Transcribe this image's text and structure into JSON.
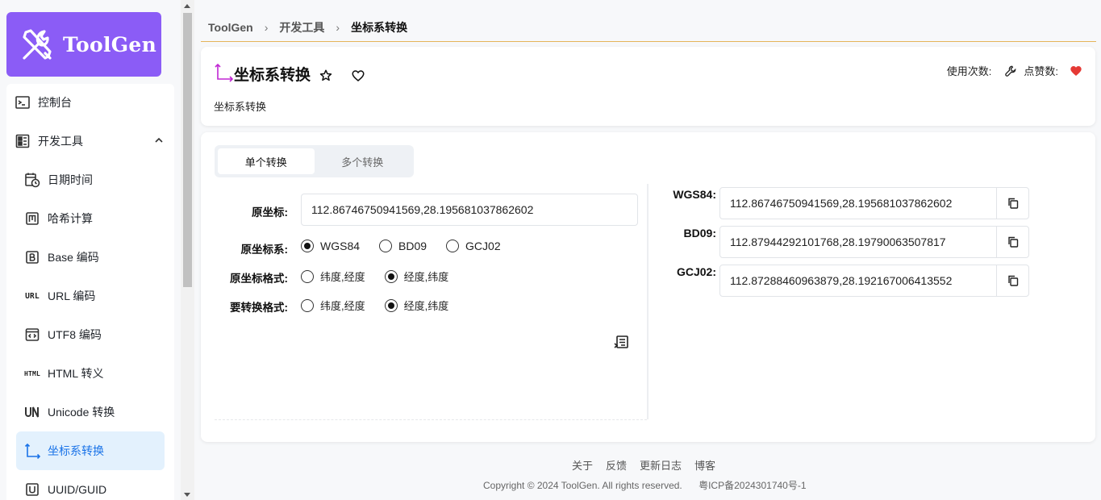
{
  "app": {
    "name": "ToolGen"
  },
  "breadcrumb": [
    "ToolGen",
    "开发工具",
    "坐标系转换"
  ],
  "sidebar": {
    "items": [
      {
        "label": "控制台",
        "icon": "terminal-icon"
      },
      {
        "label": "开发工具",
        "icon": "grid-icon",
        "expanded": true
      },
      {
        "label": "日期时间",
        "icon": "calendar-clock-icon"
      },
      {
        "label": "哈希计算",
        "icon": "hash-m-icon"
      },
      {
        "label": "Base 编码",
        "icon": "base-b-icon"
      },
      {
        "label": "URL 编码",
        "icon": "url-text-icon",
        "icon_text": "URL"
      },
      {
        "label": "UTF8 编码",
        "icon": "code-window-icon"
      },
      {
        "label": "HTML 转义",
        "icon": "html-text-icon",
        "icon_text": "HTML"
      },
      {
        "label": "Unicode 转换",
        "icon": "unicode-icon"
      },
      {
        "label": "坐标系转换",
        "icon": "axis-icon",
        "active": true
      },
      {
        "label": "UUID/GUID",
        "icon": "uuid-u-icon"
      }
    ]
  },
  "tool": {
    "title": "坐标系转换",
    "description": "坐标系转换",
    "usage_label": "使用次数:",
    "like_label": "点赞数:"
  },
  "tabs": [
    {
      "label": "单个转换",
      "active": true
    },
    {
      "label": "多个转换",
      "active": false
    }
  ],
  "form": {
    "source_label": "原坐标:",
    "source_value": "112.86746750941569,28.195681037862602",
    "system_label": "原坐标系:",
    "systems": [
      {
        "label": "WGS84",
        "checked": true
      },
      {
        "label": "BD09",
        "checked": false
      },
      {
        "label": "GCJ02",
        "checked": false
      }
    ],
    "source_format_label": "原坐标格式:",
    "target_format_label": "要转换格式:",
    "formats": [
      "纬度,经度",
      "经度,纬度"
    ],
    "source_format_selected": 1,
    "target_format_selected": 1
  },
  "results": [
    {
      "label": "WGS84:",
      "value": "112.86746750941569,28.195681037862602"
    },
    {
      "label": "BD09:",
      "value": "112.87944292101768,28.19790063507817"
    },
    {
      "label": "GCJ02:",
      "value": "112.87288460963879,28.192167006413552"
    }
  ],
  "footer": {
    "links": [
      "关于",
      "反馈",
      "更新日志",
      "博客"
    ],
    "copyright": "Copyright © 2024 ToolGen. All rights reserved.",
    "icp": "粤ICP备2024301740号-1"
  },
  "colors": {
    "brand": "#8b5cf6",
    "active_bg": "#e3f1fd",
    "active_text": "#1a73e8",
    "heart": "#e53935",
    "tool_icon": "#c026d3"
  }
}
